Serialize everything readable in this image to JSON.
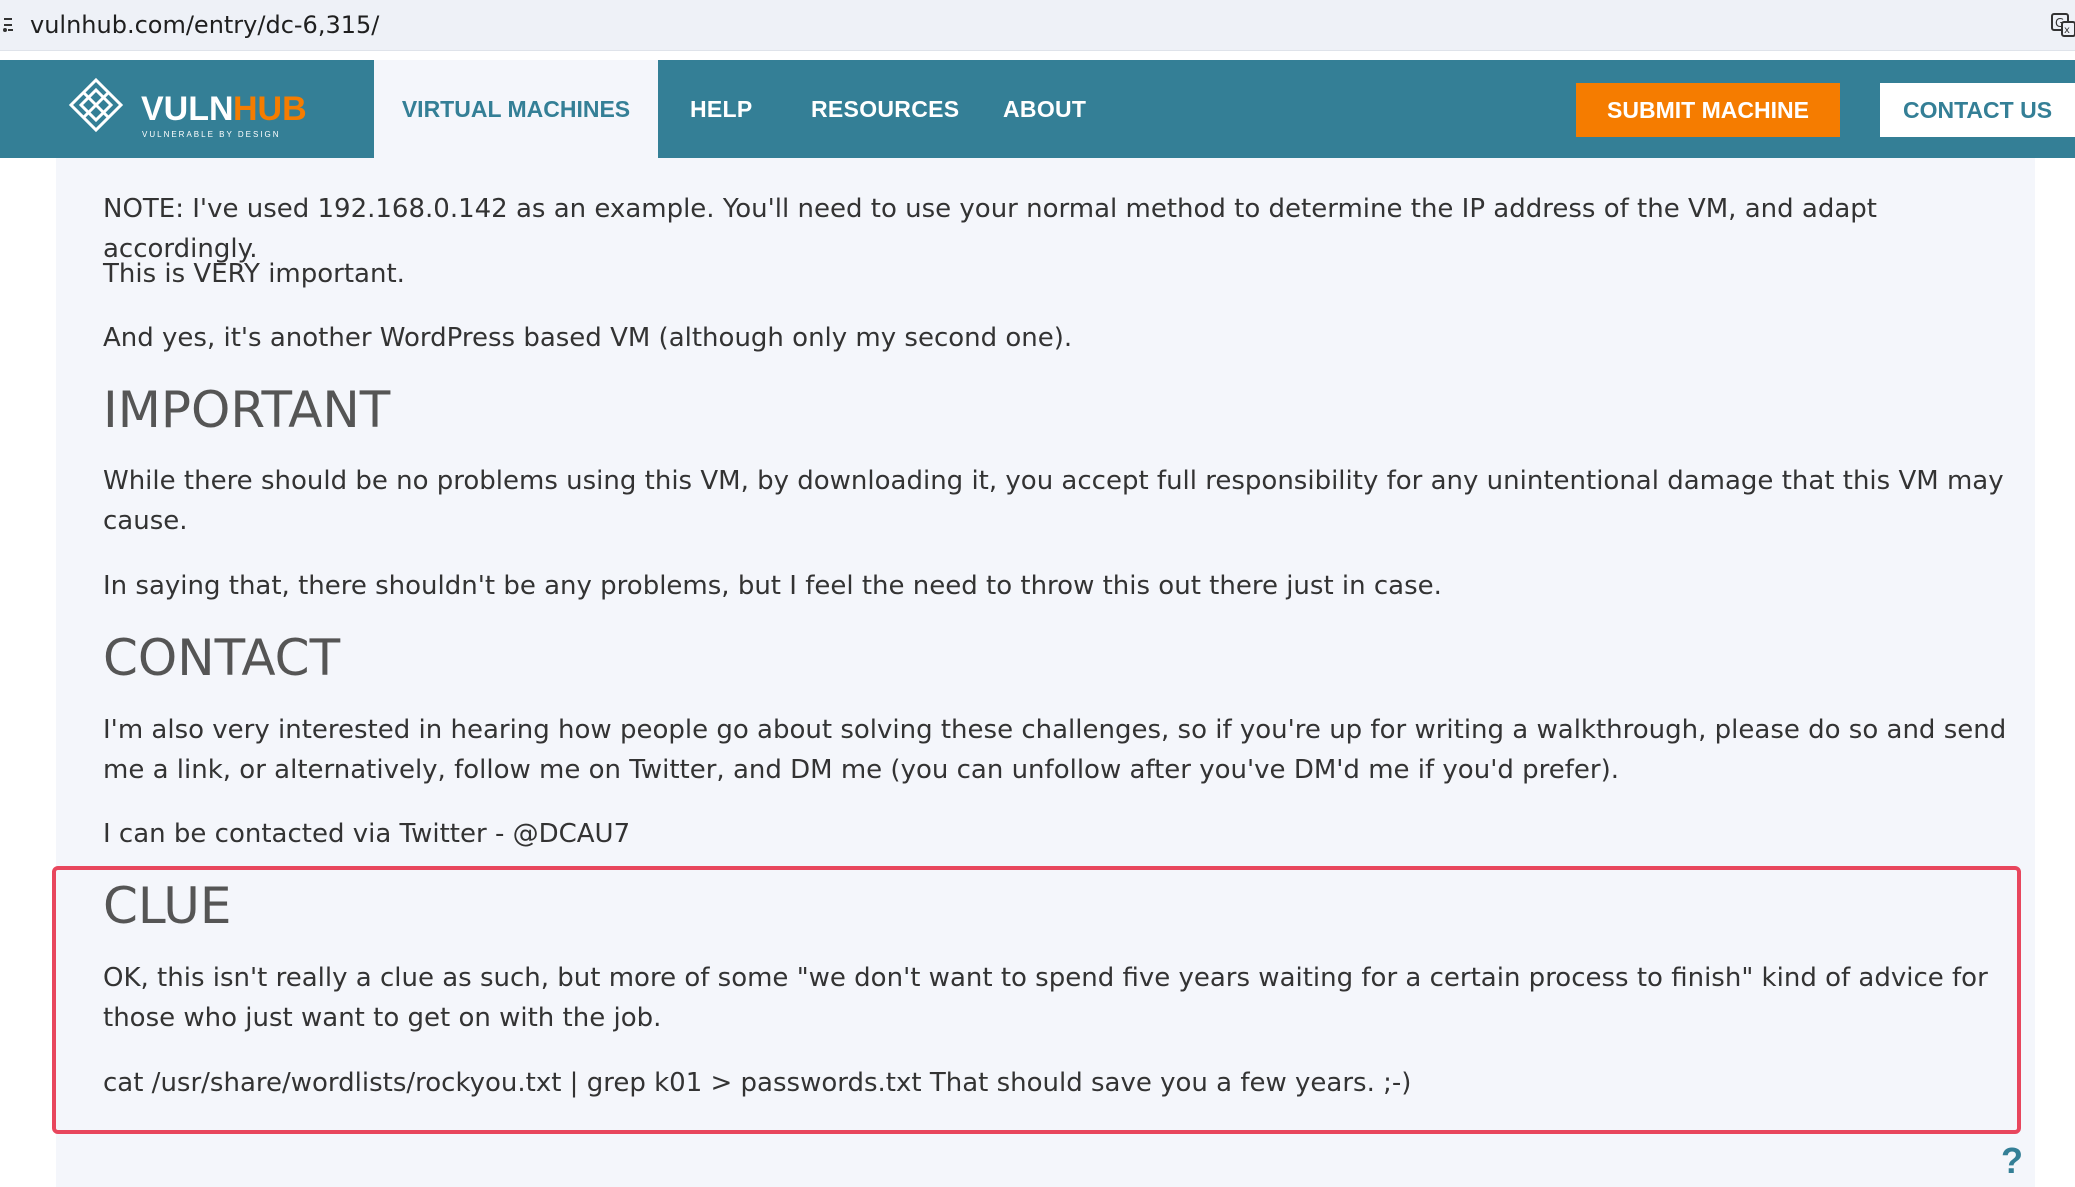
{
  "browser": {
    "url": "vulnhub.com/entry/dc-6,315/"
  },
  "nav": {
    "logo_main": "VULN",
    "logo_accent": "HUB",
    "logo_tagline": "VULNERABLE BY DESIGN",
    "items": [
      {
        "label": "VIRTUAL MACHINES"
      },
      {
        "label": "HELP"
      },
      {
        "label": "RESOURCES"
      },
      {
        "label": "ABOUT"
      }
    ],
    "submit_label": "SUBMIT MACHINE",
    "contact_label": "CONTACT US"
  },
  "colors": {
    "nav_bg": "#347f96",
    "submit_bg": "#f57c00",
    "highlight_border": "#e8465d",
    "content_bg": "#f4f6fb"
  },
  "content": {
    "note": "NOTE: I've used 192.168.0.142 as an example. You'll need to use your normal method to determine the IP address of the VM, and adapt accordingly.",
    "very_important": "This is VERY important.",
    "wordpress": "And yes, it's another WordPress based VM (although only my second one).",
    "important_heading": "IMPORTANT",
    "important_p1": "While there should be no problems using this VM, by downloading it, you accept full responsibility for any unintentional damage that this VM may cause.",
    "important_p2": "In saying that, there shouldn't be any problems, but I feel the need to throw this out there just in case.",
    "contact_heading": "CONTACT",
    "contact_p1": "I'm also very interested in hearing how people go about solving these challenges, so if you're up for writing a walkthrough, please do so and send me a link, or alternatively, follow me on Twitter, and DM me (you can unfollow after you've DM'd me if you'd prefer).",
    "contact_p2": "I can be contacted via Twitter - @DCAU7",
    "clue_heading": "CLUE",
    "clue_p1": "OK, this isn't really a clue as such, but more of some \"we don't want to spend five years waiting for a certain process to finish\" kind of advice for those who just want to get on with the job.",
    "clue_p2": "cat /usr/share/wordlists/rockyou.txt | grep k01 > passwords.txt That should save you a few years. ;-)"
  },
  "help": {
    "icon": "question-icon",
    "glyph": "?"
  }
}
